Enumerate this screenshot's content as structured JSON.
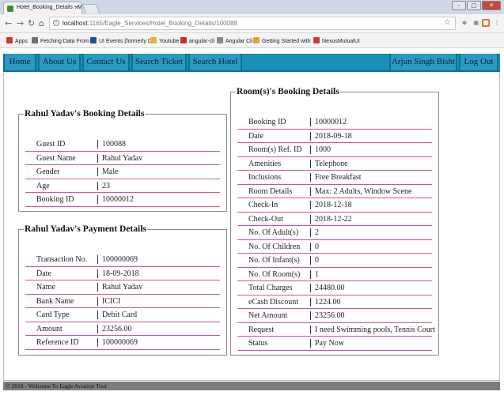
{
  "browser": {
    "tab_title": "Hotel_Booking_Details - M",
    "url_host": "localhost",
    "url_rest": ":1165/Eagle_Services/Hotel_Booking_Details/100088",
    "bookmarks": [
      {
        "label": "Apps",
        "color": "#d7362d"
      },
      {
        "label": "Fetching Data From a",
        "color": "#6f6f6f"
      },
      {
        "label": "UI Events (formerly D",
        "color": "#1e50a2"
      },
      {
        "label": "Youtube",
        "color": "#e7b52d"
      },
      {
        "label": "angular-cli",
        "color": "#c8302a"
      },
      {
        "label": "Angular Cli",
        "color": "#8a8a8a"
      },
      {
        "label": "Getting Started with",
        "color": "#e1a23d"
      },
      {
        "label": "NexusMutualUI",
        "color": "#d23b3b"
      }
    ]
  },
  "nav": {
    "home": "Home",
    "about": "About Us",
    "contact": "Contact Us",
    "search_ticket": "Search Ticket",
    "search_hotel": "Search Hotel",
    "user": "Arjun Singh Bisht",
    "logout": "Log Out"
  },
  "booking": {
    "legend": "Rahul Yadav's Booking Details",
    "rows": [
      {
        "label": "Guest ID",
        "value": "100088"
      },
      {
        "label": "Guest Name",
        "value": "Rahul Yadav"
      },
      {
        "label": "Gender",
        "value": "Male"
      },
      {
        "label": "Age",
        "value": "23"
      },
      {
        "label": "Booking ID",
        "value": "10000012"
      }
    ]
  },
  "payment": {
    "legend": "Rahul Yadav's Payment Details",
    "rows": [
      {
        "label": "Transaction No.",
        "value": "100000069"
      },
      {
        "label": "Date",
        "value": "18-09-2018"
      },
      {
        "label": "Name",
        "value": "Rahul Yadav"
      },
      {
        "label": "Bank Name",
        "value": "ICICI"
      },
      {
        "label": "Card Type",
        "value": "Debit Card"
      },
      {
        "label": "Amount",
        "value": "23256.00"
      },
      {
        "label": "Reference ID",
        "value": "100000069"
      }
    ]
  },
  "rooms": {
    "legend": "Room(s)'s Booking Details",
    "rows": [
      {
        "label": "Booking ID",
        "value": "10000012"
      },
      {
        "label": "Date",
        "value": "2018-09-18"
      },
      {
        "label": "Room(s) Ref. ID",
        "value": "1000"
      },
      {
        "label": "Amenities",
        "value": "Telephone"
      },
      {
        "label": "Inclusions",
        "value": "Free Breakfast"
      },
      {
        "label": "Room Details",
        "value": "Max: 2 Adults, Window Scene"
      },
      {
        "label": "Check-In",
        "value": "2018-12-18"
      },
      {
        "label": "Check-Out",
        "value": "2018-12-22"
      },
      {
        "label": "No. Of Adult(s)",
        "value": "2"
      },
      {
        "label": "No. Of Children",
        "value": "0"
      },
      {
        "label": "No. Of Infant(s)",
        "value": "0"
      },
      {
        "label": "No. Of Room(s)",
        "value": "1"
      },
      {
        "label": "Total Charges",
        "value": "24480.00"
      },
      {
        "label": "eCash Discount",
        "value": "1224.00"
      },
      {
        "label": "Net Amount",
        "value": "23256.00"
      },
      {
        "label": "Request",
        "value": "I need Swimming pools, Tennis Court"
      },
      {
        "label": "Status",
        "value": "Pay Now"
      }
    ]
  },
  "footer": "© 2018 - Welcome To Eagle Aviation Tour"
}
